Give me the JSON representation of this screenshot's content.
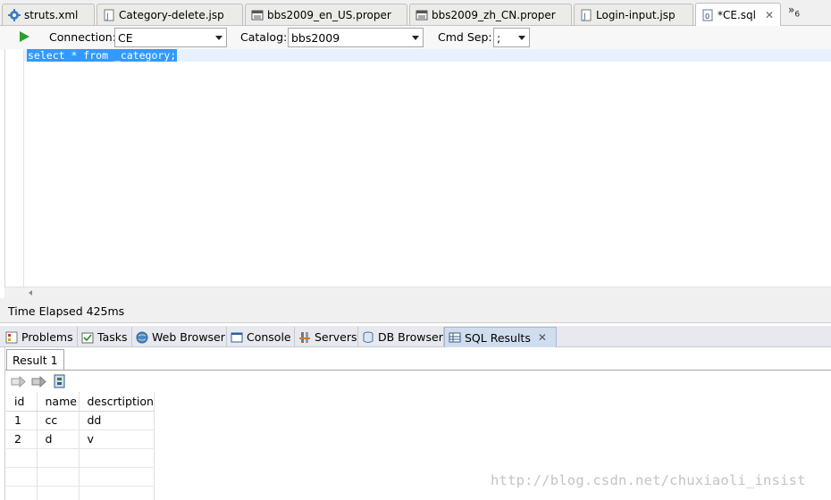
{
  "editor_tabs": [
    {
      "label": "struts.xml",
      "icon": "gear-icon"
    },
    {
      "label": "Category-delete.jsp",
      "icon": "jsp-file-icon"
    },
    {
      "label": "bbs2009_en_US.proper",
      "icon": "properties-file-icon"
    },
    {
      "label": "bbs2009_zh_CN.proper",
      "icon": "properties-file-icon"
    },
    {
      "label": "Login-input.jsp",
      "icon": "jsp-file-icon"
    },
    {
      "label": "*CE.sql",
      "icon": "sql-file-icon",
      "active": true
    }
  ],
  "overflow_count": "6",
  "toolbar": {
    "connection_label": "Connection:",
    "connection_value": "CE",
    "catalog_label": "Catalog:",
    "catalog_value": "bbs2009",
    "cmdsep_label": "Cmd Sep:",
    "cmdsep_value": ";"
  },
  "editor": {
    "code": "select * from _category;"
  },
  "status": "Time Elapsed 425ms",
  "view_tabs": [
    {
      "label": "Problems",
      "icon": "problems-icon"
    },
    {
      "label": "Tasks",
      "icon": "tasks-icon"
    },
    {
      "label": "Web Browser",
      "icon": "globe-icon"
    },
    {
      "label": "Console",
      "icon": "console-icon"
    },
    {
      "label": "Servers",
      "icon": "servers-icon"
    },
    {
      "label": "DB Browser",
      "icon": "database-icon"
    },
    {
      "label": "SQL Results",
      "icon": "table-icon",
      "active": true
    }
  ],
  "results": {
    "tab": "Result 1",
    "columns": [
      "id",
      "name",
      "descrtiption"
    ],
    "rows": [
      [
        "1",
        "cc",
        "dd"
      ],
      [
        "2",
        "d",
        "v"
      ]
    ]
  },
  "watermark": "http://blog.csdn.net/chuxiaoli_insist",
  "colors": {
    "selection": "#3399ff",
    "active_view_tab": "#cfddee",
    "run": "#2aa02a"
  }
}
